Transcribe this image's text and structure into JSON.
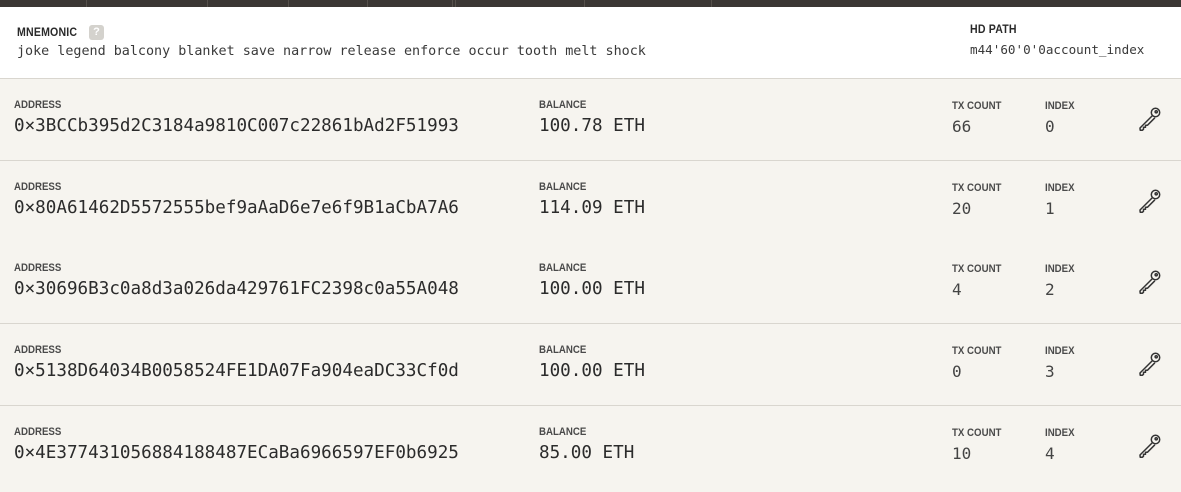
{
  "header": {
    "mnemonic_label": "MNEMONIC",
    "help_label": "?",
    "mnemonic": "joke legend balcony blanket save narrow release enforce occur tooth melt shock",
    "hd_path_label": "HD PATH",
    "hd_path": "m44'60'0'0account_index"
  },
  "columns": {
    "address": "ADDRESS",
    "balance": "BALANCE",
    "tx_count": "TX COUNT",
    "index": "INDEX"
  },
  "accounts": [
    {
      "address": "0×3BCCb395d2C3184a9810C007c22861bAd2F51993",
      "balance": "100.78 ETH",
      "tx_count": "66",
      "index": "0"
    },
    {
      "address": "0×80A61462D5572555bef9aAaD6e7e6f9B1aCbA7A6",
      "balance": "114.09 ETH",
      "tx_count": "20",
      "index": "1"
    },
    {
      "address": "0×30696B3c0a8d3a026da429761FC2398c0a55A048",
      "balance": "100.00 ETH",
      "tx_count": "4",
      "index": "2"
    },
    {
      "address": "0×5138D64034B0058524FE1DA07Fa904eaDC33Cf0d",
      "balance": "100.00 ETH",
      "tx_count": "0",
      "index": "3"
    },
    {
      "address": "0×4E377431056884188487ECaBa6966597EF0b6925",
      "balance": "85.00 ETH",
      "tx_count": "10",
      "index": "4"
    }
  ],
  "icons": {
    "key": "key-icon",
    "help": "help-icon"
  },
  "colors": {
    "topbar": "#3b3734",
    "background": "#f6f4ef",
    "header_background": "#ffffff",
    "divider": "#d9d6cf"
  }
}
